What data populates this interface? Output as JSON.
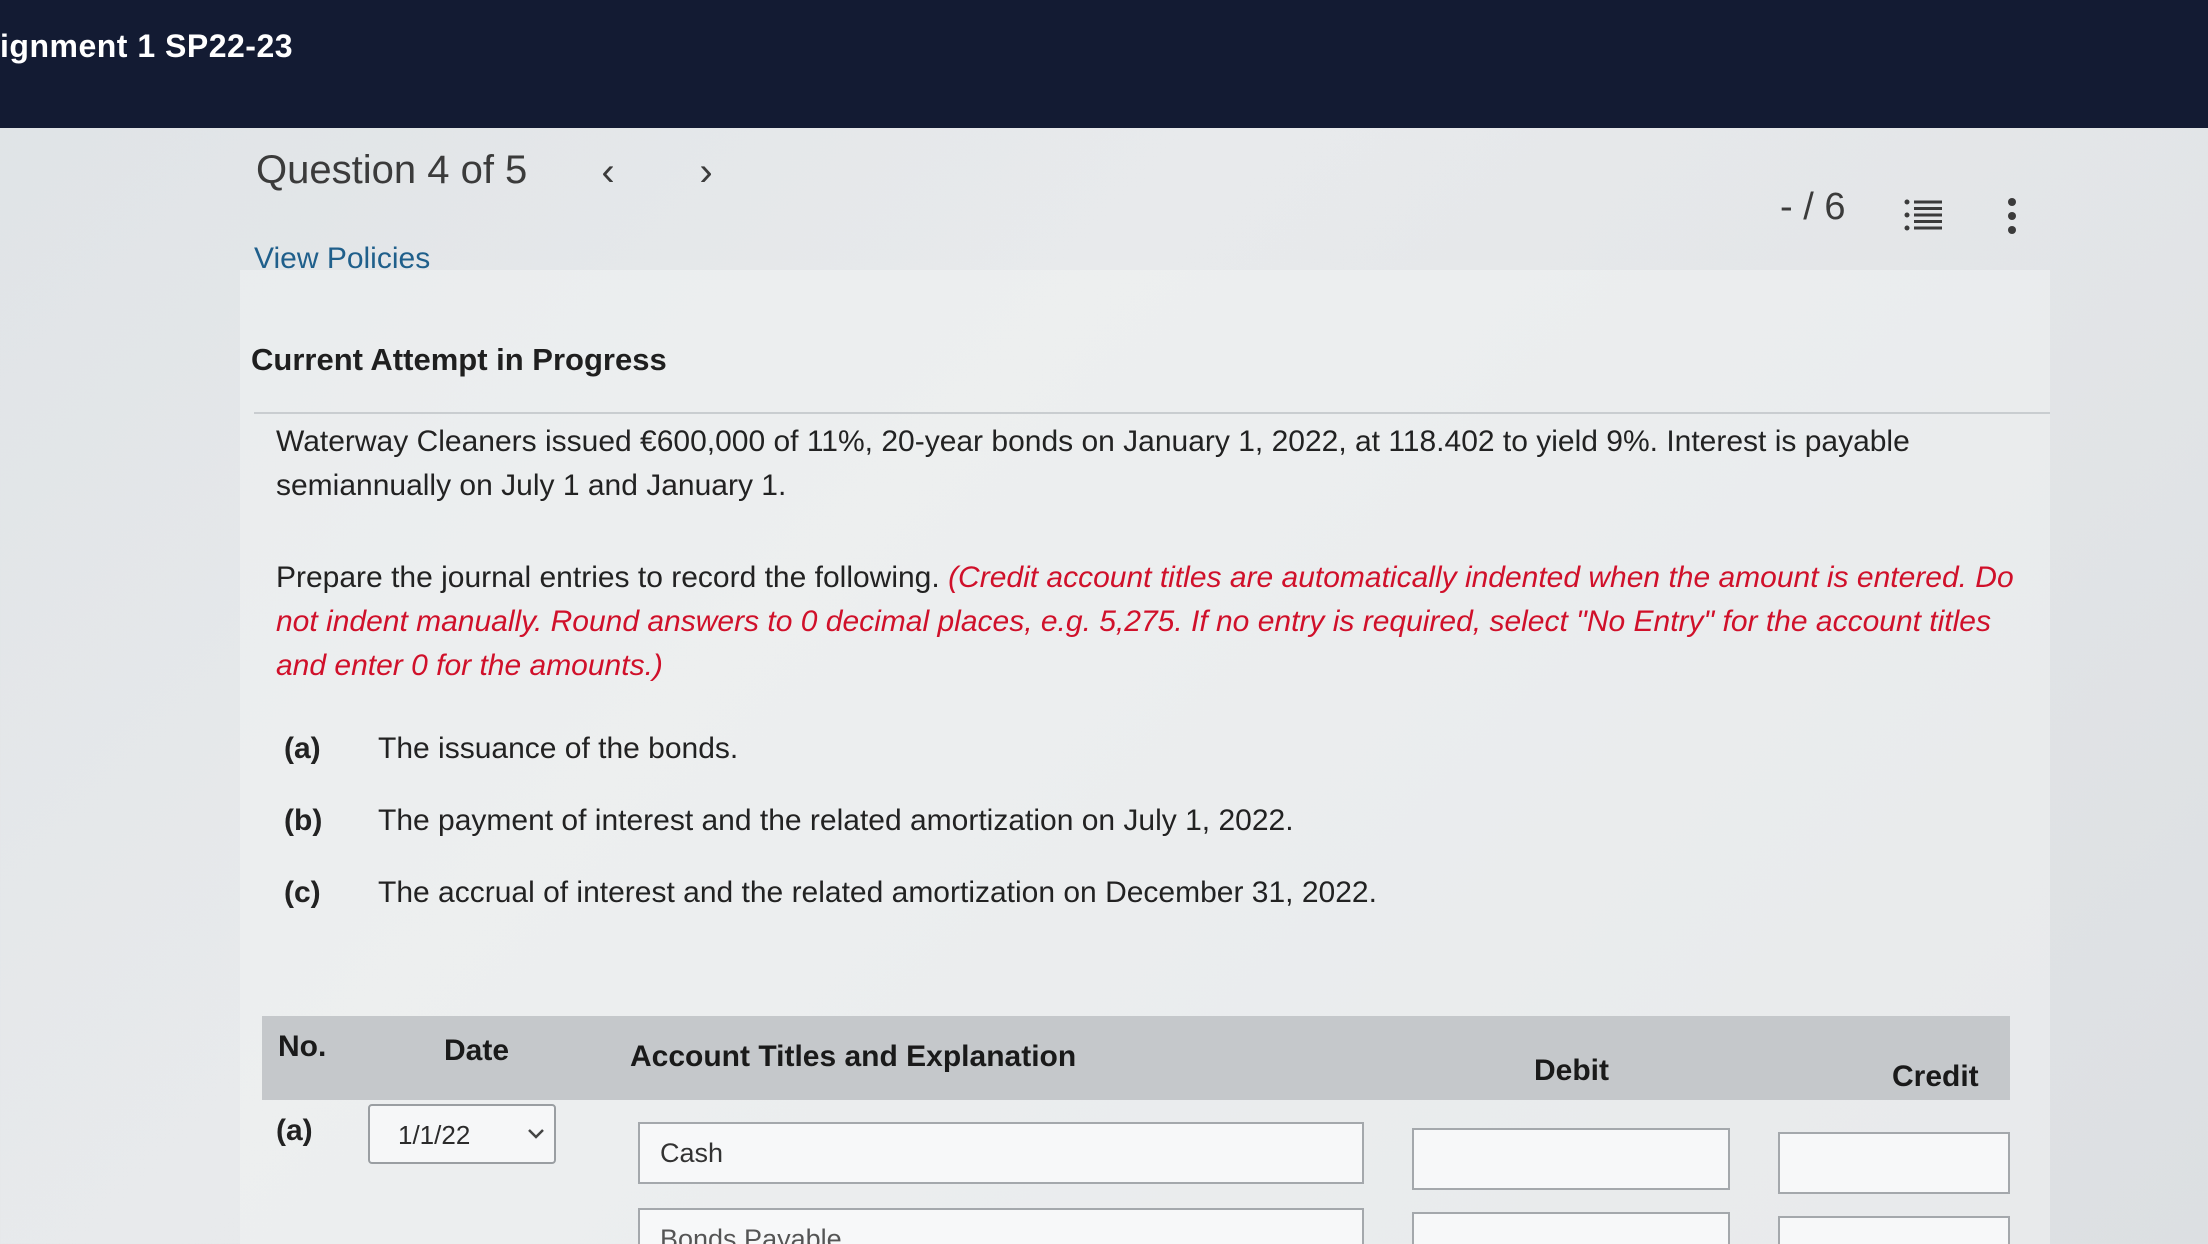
{
  "window": {
    "title": "ignment 1 SP22-23"
  },
  "question": {
    "header": "Question 4 of 5",
    "prev_arrow": "‹",
    "next_arrow": "›",
    "score": "- / 6",
    "view_policies": "View Policies",
    "attempt_status": "Current Attempt in Progress"
  },
  "problem": {
    "statement": "Waterway Cleaners issued €600,000 of 11%, 20-year bonds on January 1, 2022, at 118.402 to yield 9%. Interest is payable semiannually on July 1 and January 1.",
    "instruction": "Prepare the journal entries to record the following.",
    "note": "(Credit account titles are automatically indented when the amount is entered. Do not indent manually. Round answers to 0 decimal places, e.g. 5,275. If no entry is required, select \"No Entry\" for the account titles and enter 0 for the amounts.)",
    "parts": [
      {
        "letter": "(a)",
        "text": "The issuance of the bonds."
      },
      {
        "letter": "(b)",
        "text": "The payment of interest and the related amortization on July 1, 2022."
      },
      {
        "letter": "(c)",
        "text": "The accrual of interest and the related amortization on December 31, 2022."
      }
    ]
  },
  "table": {
    "headers": {
      "no": "No.",
      "date": "Date",
      "account": "Account Titles and Explanation",
      "debit": "Debit",
      "credit": "Credit"
    },
    "rows": [
      {
        "no": "(a)",
        "date": "1/1/22",
        "account": "Cash",
        "debit": "",
        "credit": ""
      },
      {
        "no": "",
        "date": "",
        "account": "Bonds Payable",
        "debit": "",
        "credit": ""
      }
    ]
  },
  "colors": {
    "topbar": "#131b33",
    "link": "#1f5f8b",
    "note_red": "#d0102a",
    "table_header": "#c5c8cb"
  },
  "icons": {
    "list": "list-icon",
    "more": "kebab-menu-icon",
    "dropdown": "chevron-down-icon"
  }
}
